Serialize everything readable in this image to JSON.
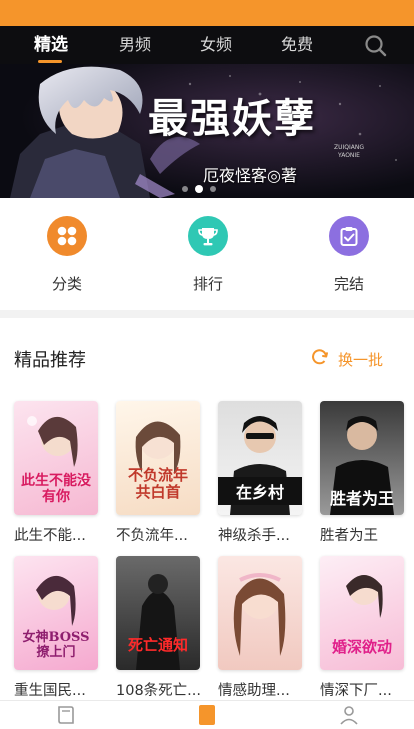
{
  "colors": {
    "accent": "#f5952b",
    "nav_bg": "#0d0d10"
  },
  "nav": {
    "tabs": [
      {
        "label": "精选",
        "active": true
      },
      {
        "label": "男频"
      },
      {
        "label": "女频"
      },
      {
        "label": "免费"
      }
    ],
    "search_icon": "search-icon"
  },
  "banner": {
    "title": "最强妖孽",
    "pinyin": "ZUIQIANG YAONIE",
    "author": "厄夜怪客◎著",
    "slides": 3,
    "active_slide": 2
  },
  "categories": [
    {
      "label": "分类",
      "icon": "grid-icon",
      "color": "#f08a2c"
    },
    {
      "label": "排行",
      "icon": "trophy-icon",
      "color": "#2fc8b4"
    },
    {
      "label": "完结",
      "icon": "clipboard-check-icon",
      "color": "#8c6fe0"
    }
  ],
  "recommend": {
    "title": "精品推荐",
    "refresh_label": "换一批",
    "refresh_icon": "refresh-icon",
    "books": [
      {
        "name": "此生不能...",
        "cover_text": "此生不能没有你"
      },
      {
        "name": "不负流年...",
        "cover_text": "不负流年共白首"
      },
      {
        "name": "神级杀手...",
        "cover_text": "在乡村"
      },
      {
        "name": "胜者为王",
        "cover_text": "胜者为王"
      },
      {
        "name": "重生国民...",
        "cover_text": "女神BOSS撩上门"
      },
      {
        "name": "108条死亡...",
        "cover_text": "死亡通知"
      },
      {
        "name": "情感助理...",
        "cover_text": ""
      },
      {
        "name": "情深下厂...",
        "cover_text": "婚深欲动"
      }
    ]
  },
  "bottom_nav": [
    {
      "icon": "bookshelf-icon"
    },
    {
      "icon": "book-store-icon",
      "active": true
    },
    {
      "icon": "profile-icon"
    }
  ]
}
